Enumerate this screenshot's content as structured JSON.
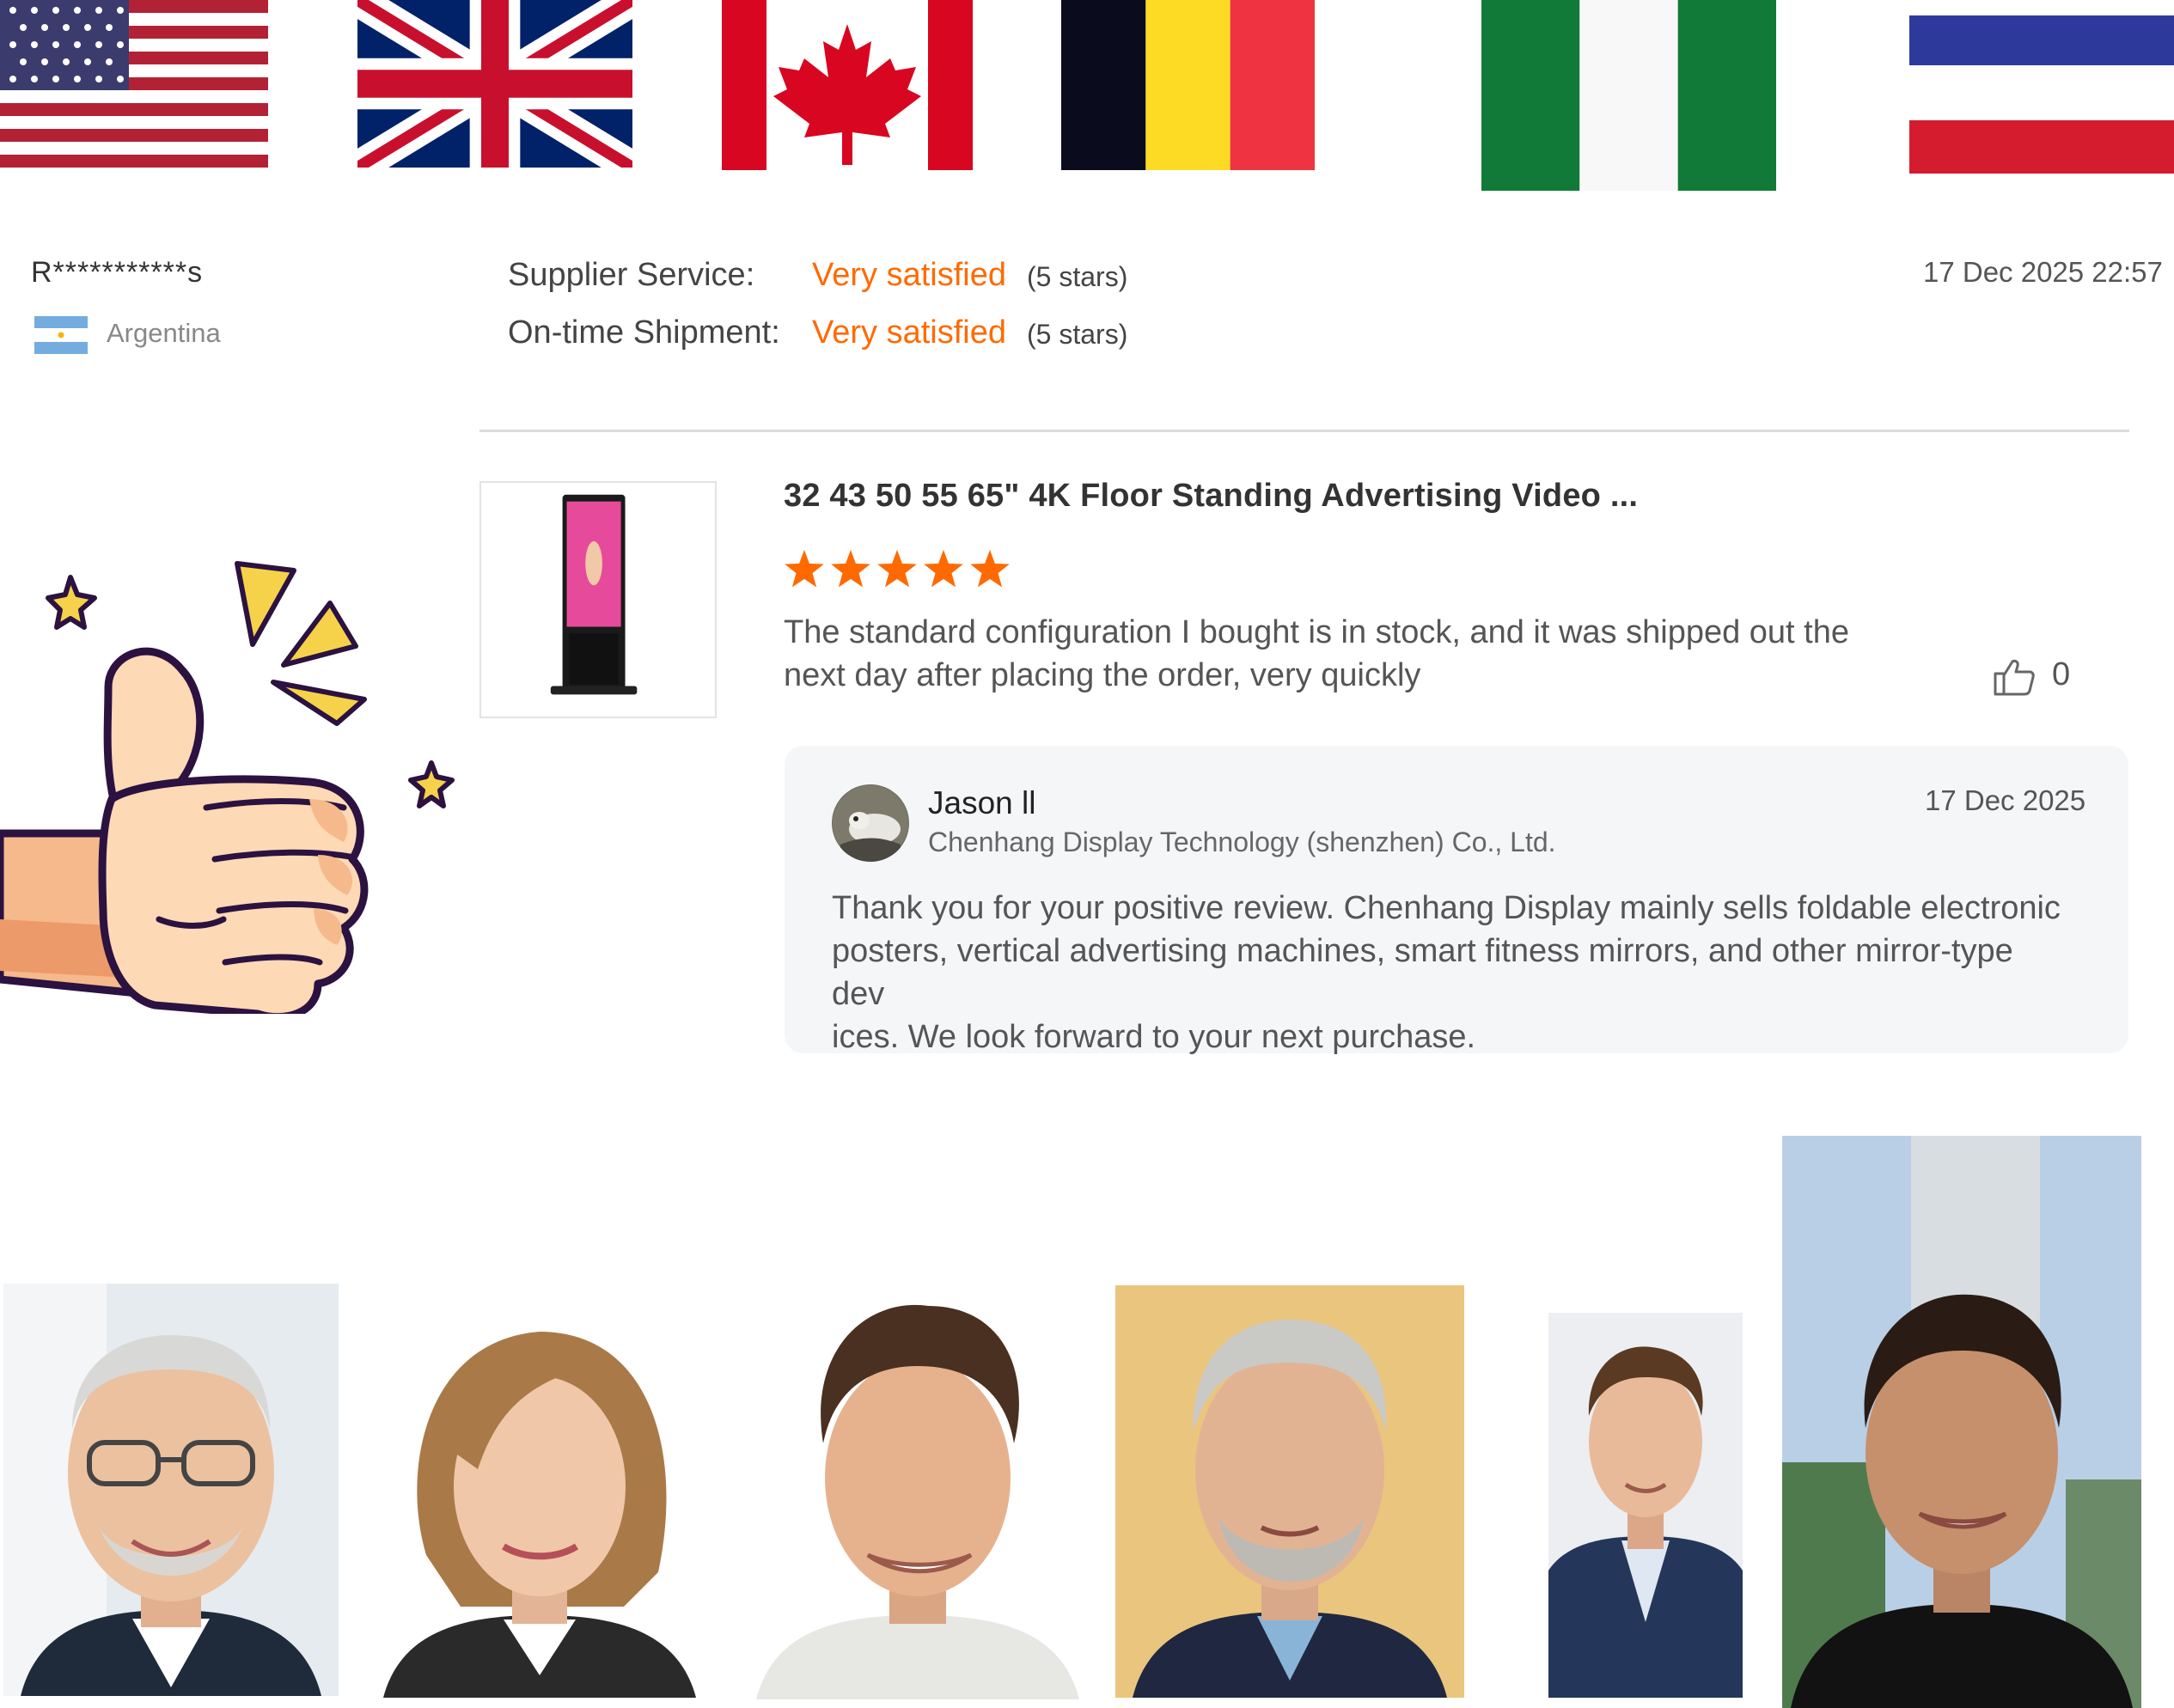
{
  "flags": [
    {
      "name": "united-states-flag-icon"
    },
    {
      "name": "united-kingdom-flag-icon"
    },
    {
      "name": "canada-flag-icon"
    },
    {
      "name": "belgium-flag-icon"
    },
    {
      "name": "nigeria-flag-icon"
    },
    {
      "name": "thailand-flag-icon"
    }
  ],
  "reviewer": {
    "masked_name": "R***********s",
    "country": "Argentina"
  },
  "ratings": {
    "supplier_service_label": "Supplier Service:",
    "supplier_service_value": "Very satisfied",
    "supplier_service_stars": "(5 stars)",
    "shipment_label": "On-time Shipment:",
    "shipment_value": "Very satisfied",
    "shipment_stars": "(5 stars)"
  },
  "review_datetime": "17 Dec 2025 22:57",
  "product": {
    "title": "32 43 50 55 65\" 4K Floor Standing Advertising Video ..."
  },
  "review": {
    "stars_filled": 5,
    "stars_total": 5,
    "text_line1": "The standard configuration I bought is in stock, and it was shipped out the",
    "text_line2": "next day after placing the order, very quickly",
    "likes": "0"
  },
  "reply": {
    "name": "Jason ll",
    "company": "Chenhang Display Technology (shenzhen) Co., Ltd.",
    "date": "17 Dec 2025",
    "text_line1": "Thank you for your positive review. Chenhang Display mainly sells foldable electronic",
    "text_line2": "posters, vertical advertising machines, smart fitness mirrors, and other mirror-type dev",
    "text_line3": "ices. We look forward to your next purchase."
  },
  "colors": {
    "accent_orange": "#ff6a00",
    "reply_bg": "#f5f6f8",
    "divider": "#dcdcdc"
  },
  "portraits": [
    {
      "name": "portrait-older-man-glasses"
    },
    {
      "name": "portrait-woman-blonde"
    },
    {
      "name": "portrait-young-man-curly-hair"
    },
    {
      "name": "portrait-older-man-gray-beard"
    },
    {
      "name": "portrait-man-suit"
    },
    {
      "name": "portrait-woman-dark-hair"
    }
  ]
}
